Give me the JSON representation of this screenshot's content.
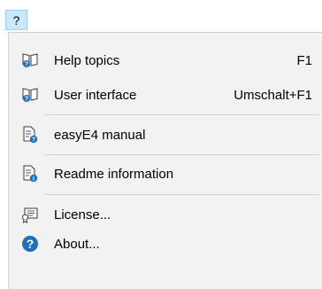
{
  "menubar": {
    "help_label": "?"
  },
  "menu": {
    "items": [
      {
        "label": "Help topics",
        "shortcut": "F1",
        "icon": "help-book-icon"
      },
      {
        "label": "User interface",
        "shortcut": "Umschalt+F1",
        "icon": "help-book-icon"
      },
      {
        "label": "easyE4 manual",
        "shortcut": "",
        "icon": "document-help-icon"
      },
      {
        "label": "Readme information",
        "shortcut": "",
        "icon": "document-info-icon"
      },
      {
        "label": "License...",
        "shortcut": "",
        "icon": "license-icon"
      },
      {
        "label": "About...",
        "shortcut": "",
        "icon": "about-icon"
      }
    ]
  }
}
